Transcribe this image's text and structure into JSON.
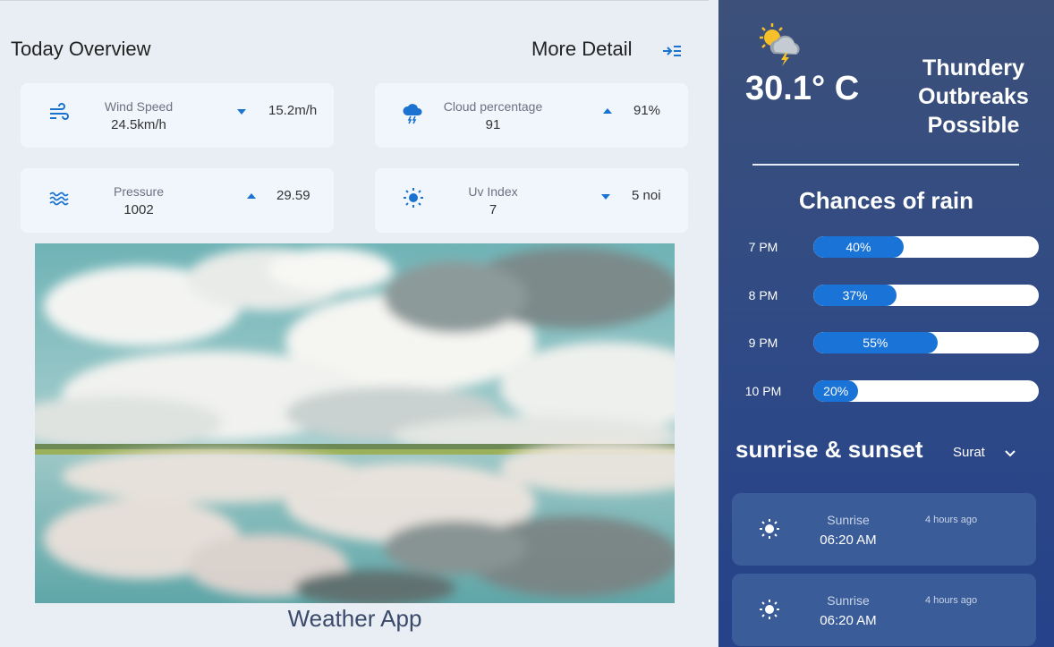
{
  "overview": {
    "title": "Today Overview",
    "more_detail": "More Detail",
    "cards": [
      {
        "icon": "wind-icon",
        "label": "Wind Speed",
        "value": "24.5km/h",
        "trend": "down",
        "side": "15.2m/h"
      },
      {
        "icon": "cloud-thunder-icon",
        "label": "Cloud percentage",
        "value": "91",
        "trend": "up",
        "side": "91%"
      },
      {
        "icon": "pressure-waves-icon",
        "label": "Pressure",
        "value": "1002",
        "trend": "up",
        "side": "29.59"
      },
      {
        "icon": "sun-icon",
        "label": "Uv Index",
        "value": "7",
        "trend": "down",
        "side": "5 noi"
      }
    ],
    "app_title": "Weather App"
  },
  "current": {
    "icon": "sun-behind-thunder-cloud-icon",
    "temperature": "30.1° C",
    "condition": "Thundery Outbreaks Possible"
  },
  "rain": {
    "title": "Chances of rain",
    "rows": [
      {
        "time": "7 PM",
        "percent": 40,
        "label": "40%"
      },
      {
        "time": "8 PM",
        "percent": 37,
        "label": "37%"
      },
      {
        "time": "9 PM",
        "percent": 55,
        "label": "55%"
      },
      {
        "time": "10 PM",
        "percent": 20,
        "label": "20%"
      }
    ]
  },
  "sun": {
    "title": "sunrise & sunset",
    "city": "Surat",
    "cards": [
      {
        "label": "Sunrise",
        "time": "06:20 AM",
        "ago": "4 hours ago"
      },
      {
        "label": "Sunrise",
        "time": "06:20 AM",
        "ago": "4 hours ago"
      }
    ]
  },
  "colors": {
    "accent": "#1a73d6",
    "panel": "#2f4a86",
    "card": "#f1f6fc"
  }
}
